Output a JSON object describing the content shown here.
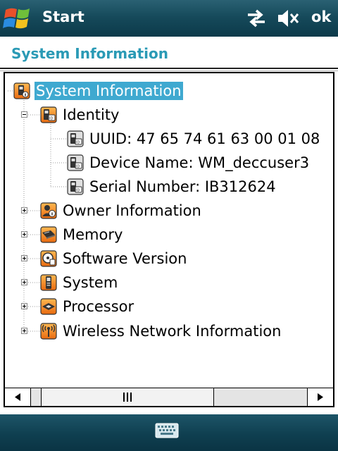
{
  "title_bar": {
    "title": "Start",
    "ok_label": "ok",
    "icons": [
      "windows-start-logo",
      "connectivity-icon",
      "volume-muted-icon"
    ]
  },
  "page": {
    "title": "System Information"
  },
  "tree": {
    "root": {
      "label": "System Information",
      "icon": "system-info-icon",
      "selected": true,
      "expanded": true
    },
    "identity": {
      "label": "Identity",
      "icon": "identity-icon",
      "expanded": true,
      "children": [
        {
          "label": "UUID: 47 65 74 61 63 00 01 08",
          "icon": "id-card-icon"
        },
        {
          "label": "Device Name: WM_deccuser3",
          "icon": "id-card-icon"
        },
        {
          "label": "Serial Number: IB312624",
          "icon": "id-card-icon"
        }
      ]
    },
    "collapsed": [
      {
        "label": "Owner Information",
        "icon": "owner-info-icon"
      },
      {
        "label": "Memory",
        "icon": "memory-icon"
      },
      {
        "label": "Software Version",
        "icon": "software-version-icon"
      },
      {
        "label": "System",
        "icon": "system-icon"
      },
      {
        "label": "Processor",
        "icon": "processor-icon"
      },
      {
        "label": "Wireless Network Information",
        "icon": "wireless-icon"
      }
    ]
  },
  "scrollbar": {
    "thumb_position": 0.07,
    "thumb_fraction": 0.63
  },
  "bottom_bar": {
    "icon": "keyboard-icon"
  },
  "colors": {
    "accent": "#2a9ab5",
    "selection": "#3fa9d0",
    "title_bar": "#164a5b",
    "icon_orange": "#f08a1c"
  }
}
